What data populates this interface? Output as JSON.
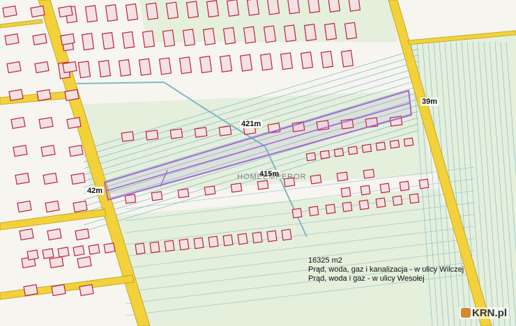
{
  "map": {
    "colors": {
      "background": "#f7f5ef",
      "field_green": "#e4efdc",
      "road_yellow": "#f2d13a",
      "road_border": "#b89c1c",
      "parcel_line": "#7fb8c6",
      "building_fill": "#f3e2e4",
      "building_outline": "#c0203a",
      "highlight_parcel": "#a06ad0"
    },
    "measurements": {
      "length_top": "421m",
      "length_bottom": "415m",
      "width_right": "39m",
      "width_left": "42m"
    },
    "info": {
      "area": "16325 m2",
      "line1": "Prąd, woda, gaz i kanalizacja - w ulicy Wilczej",
      "line2": "Prąd, woda i gaz - w ulicy Wesołej"
    },
    "watermark": "HOMEEMPEROR",
    "logo_text": "KRN.pl"
  }
}
